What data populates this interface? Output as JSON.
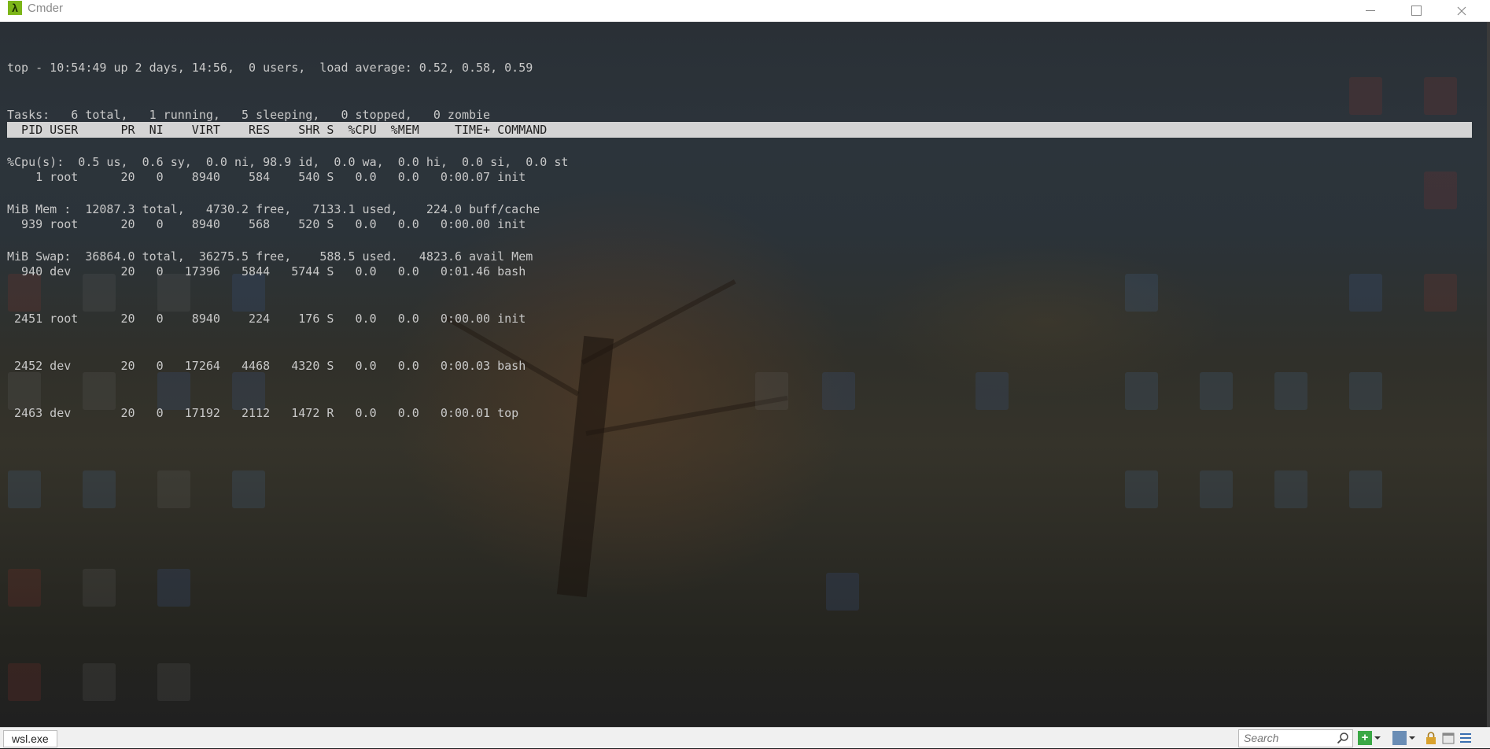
{
  "window": {
    "title": "Cmder",
    "app_icon_glyph": "λ",
    "accent_color": "#7cb518"
  },
  "terminal": {
    "summary_lines": [
      "top - 10:54:49 up 2 days, 14:56,  0 users,  load average: 0.52, 0.58, 0.59",
      "Tasks:   6 total,   1 running,   5 sleeping,   0 stopped,   0 zombie",
      "%Cpu(s):  0.5 us,  0.6 sy,  0.0 ni, 98.9 id,  0.0 wa,  0.0 hi,  0.0 si,  0.0 st",
      "MiB Mem :  12087.3 total,   4730.2 free,   7133.1 used,    224.0 buff/cache",
      "MiB Swap:  36864.0 total,  36275.5 free,    588.5 used.   4823.6 avail Mem"
    ],
    "header": "  PID USER      PR  NI    VIRT    RES    SHR S  %CPU  %MEM     TIME+ COMMAND",
    "process_rows": [
      "    1 root      20   0    8940    584    540 S   0.0   0.0   0:00.07 init",
      "  939 root      20   0    8940    568    520 S   0.0   0.0   0:00.00 init",
      "  940 dev       20   0   17396   5844   5744 S   0.0   0.0   0:01.46 bash",
      " 2451 root      20   0    8940    224    176 S   0.0   0.0   0:00.00 init",
      " 2452 dev       20   0   17264   4468   4320 S   0.0   0.0   0:00.03 bash",
      " 2463 dev       20   0   17192   2112   1472 R   0.0   0.0   0:00.01 top"
    ]
  },
  "statusbar": {
    "tab_label": "wsl.exe",
    "search_placeholder": "Search",
    "new_console_glyph": "+"
  }
}
